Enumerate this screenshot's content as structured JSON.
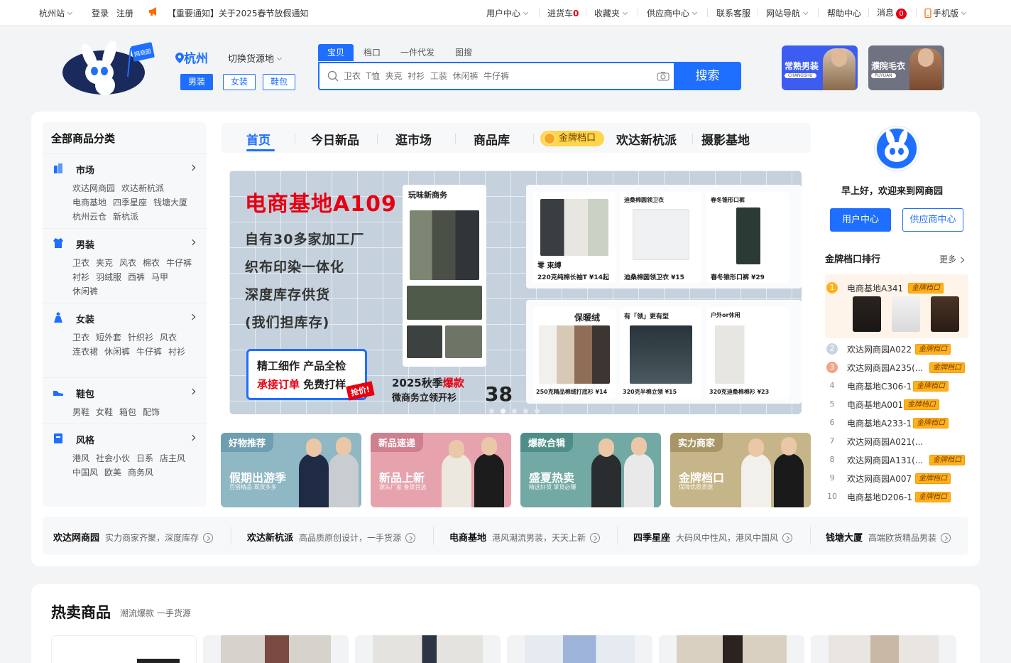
{
  "topbar": {
    "city": "杭州站",
    "login": "登录",
    "register": "注册",
    "notice": "【重要通知】关于2025春节放假通知",
    "user_center": "用户中心",
    "cart": "进货车",
    "cart_count": "0",
    "favorites": "收藏夹",
    "supply_center": "供应商中心",
    "service": "联系客服",
    "site_nav": "网站导航",
    "help": "帮助中心",
    "messages": "消息",
    "message_count": "0",
    "mobile": "手机版"
  },
  "header": {
    "logo_tag": "网商园",
    "city": "杭州",
    "switch_label": "切换货源地",
    "genders": [
      "男装",
      "女装",
      "鞋包"
    ],
    "search_tabs": [
      "宝贝",
      "档口",
      "一件代发",
      "图搜"
    ],
    "search_placeholder": "卫衣  T恤  夹克  衬衫  工装  休闲裤  牛仔裤",
    "search_button": "搜索",
    "promos": [
      {
        "title": "常熟男装",
        "sub": "CHANGSHU",
        "bg": "#3d5cf0"
      },
      {
        "title": "濮院毛衣",
        "sub": "PUYUAN",
        "bg": "#6f7280"
      }
    ]
  },
  "category": {
    "title": "全部商品分类",
    "groups": [
      {
        "name": "市场",
        "links": [
          "欢达网商园",
          "欢达新杭派",
          "电商基地",
          "四季星座",
          "钱塘大厦",
          "杭州云仓",
          "新杭派"
        ]
      },
      {
        "name": "男装",
        "links": [
          "卫衣",
          "夹克",
          "风衣",
          "棉衣",
          "牛仔裤",
          "衬衫",
          "羽绒服",
          "西裤",
          "马甲",
          "休闲裤"
        ]
      },
      {
        "name": "女装",
        "links": [
          "卫衣",
          "短外套",
          "针织衫",
          "风衣",
          "连衣裙",
          "休闲裤",
          "牛仔裤",
          "衬衫"
        ]
      },
      {
        "name": "鞋包",
        "links": [
          "男鞋",
          "女鞋",
          "箱包",
          "配饰"
        ]
      },
      {
        "name": "风格",
        "links": [
          "港风",
          "社会小伙",
          "日系",
          "店主风",
          "中国风",
          "欧美",
          "商务风"
        ]
      }
    ]
  },
  "nav": {
    "items": [
      "首页",
      "今日新品",
      "逛市场",
      "商品库",
      "金牌档口",
      "欢达新杭派",
      "摄影基地"
    ]
  },
  "banner": {
    "title": "电商基地A109",
    "lines": [
      "自有30多家加工厂",
      "织布印染一体化",
      "深度库存供货",
      "(我们担库存)"
    ],
    "box_line1": "精工细作 产品全检",
    "box_hl": "承接订单",
    "box_line2": " 免费打样",
    "stamp": "抢价!",
    "season_pre": "2025秋季",
    "season_hl": "爆款",
    "season_sub": "微商务立领开衫",
    "price_num": "38",
    "tile_titles": [
      "玩味新商务",
      "迪桑棉圆领卫衣",
      "春冬锥形口裤",
      "保暖绒",
      "有「领」更有型",
      "户外or休闲"
    ],
    "tile_prices": [
      "220克纯棉长袖T  ¥14起",
      "迪桑棉圆领卫衣  ¥15",
      "春冬锥形口裤  ¥29",
      "250克精品棉绒打底衫  ¥14",
      "320克半棉立领  ¥15",
      "320克迪桑棉棉衫  ¥23"
    ],
    "tile_label": "零 束缚"
  },
  "mini_cards": [
    {
      "tag": "好物推荐",
      "title": "假期出游季",
      "sub": "百搭精品 现货多多",
      "bg": "#8fb7c4",
      "tagbg": "#6e9eb0"
    },
    {
      "tag": "新品速递",
      "title": "新品上新",
      "sub": "源头厂家 备货首选",
      "bg": "#e6a3ae",
      "tagbg": "#cf7f8f"
    },
    {
      "tag": "爆款合辑",
      "title": "盛夏热卖",
      "sub": "精选好货 掌货必爆",
      "bg": "#73a9a4",
      "tagbg": "#4f8e88"
    },
    {
      "tag": "实力商家",
      "title": "金牌档口",
      "sub": "保障优质货源",
      "bg": "#c6b588",
      "tagbg": "#a89565"
    }
  ],
  "strip": [
    {
      "name": "欢达网商园",
      "desc": "实力商家齐聚，深度库存"
    },
    {
      "name": "欢达新杭派",
      "desc": "高品质原创设计，一手货源"
    },
    {
      "name": "电商基地",
      "desc": "港风潮流男装，天天上新"
    },
    {
      "name": "四季星座",
      "desc": "大码风中性风，港风中国风"
    },
    {
      "name": "钱塘大厦",
      "desc": "高端欧货精品男装"
    }
  ],
  "user": {
    "greeting": "早上好，欢迎来到网商园",
    "user_center": "用户中心",
    "supplier_center": "供应商中心"
  },
  "ranking": {
    "title": "金牌档口排行",
    "more": "更多",
    "badge": "金牌档口",
    "rows": [
      {
        "no": "1",
        "name": "电商基地A341"
      },
      {
        "no": "2",
        "name": "欢达网商园A022"
      },
      {
        "no": "3",
        "name": "欢达网商园A235(..."
      },
      {
        "no": "4",
        "name": "电商基地C306-1"
      },
      {
        "no": "5",
        "name": "电商基地A001"
      },
      {
        "no": "6",
        "name": "电商基地A233-1"
      },
      {
        "no": "7",
        "name": "欢达网商园A021(..."
      },
      {
        "no": "8",
        "name": "欢达网商园A131(..."
      },
      {
        "no": "9",
        "name": "欢达网商园A007"
      },
      {
        "no": "10",
        "name": "电商基地D206-1"
      }
    ]
  },
  "hot": {
    "title": "热卖商品",
    "subtitle": "潮流爆款 一手货源"
  }
}
